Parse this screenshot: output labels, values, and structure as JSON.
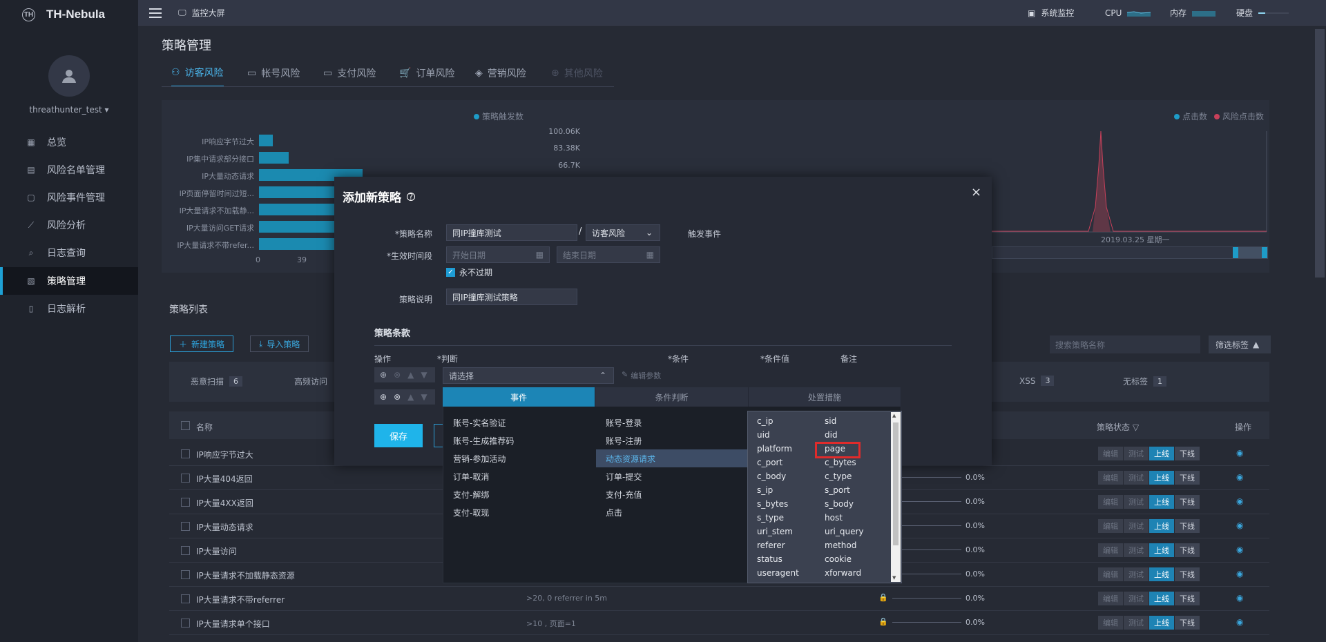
{
  "app": {
    "name": "TH-Nebula",
    "logo_mark": "TH"
  },
  "user": {
    "name": "threathunter_test"
  },
  "sidebar": {
    "items": [
      {
        "label": "总览",
        "icon": "grid-icon"
      },
      {
        "label": "风险名单管理",
        "icon": "id-card-icon"
      },
      {
        "label": "风险事件管理",
        "icon": "document-icon"
      },
      {
        "label": "风险分析",
        "icon": "line-chart-icon"
      },
      {
        "label": "日志查询",
        "icon": "search-icon"
      },
      {
        "label": "策略管理",
        "icon": "strategy-icon",
        "active": true
      },
      {
        "label": "日志解析",
        "icon": "file-icon"
      }
    ]
  },
  "topbar": {
    "monitor": "监控大屏",
    "system": "系统监控",
    "cpu": "CPU",
    "memory": "内存",
    "disk": "硬盘"
  },
  "page": {
    "title": "策略管理"
  },
  "tabs": [
    {
      "label": "访客风险",
      "icon": "user-icon",
      "active": true
    },
    {
      "label": "帐号风险",
      "icon": "account-icon"
    },
    {
      "label": "支付风险",
      "icon": "card-icon"
    },
    {
      "label": "订单风险",
      "icon": "cart-icon"
    },
    {
      "label": "营销风险",
      "icon": "tag-icon"
    },
    {
      "label": "其他风险",
      "icon": "plus-circle-icon",
      "disabled": true
    }
  ],
  "chart_data": [
    {
      "type": "bar",
      "legend": [
        "策略触发数"
      ],
      "categories": [
        "IP响应字节过大",
        "IP集中请求部分接口",
        "IP大量动态请求",
        "IP页面停留时间过短...",
        "IP大量请求不加载静...",
        "IP大量访问GET请求",
        "IP大量请求不带refer..."
      ],
      "values": [
        6,
        13,
        45,
        52,
        50,
        48,
        44
      ],
      "xticks": [
        "0",
        "39"
      ],
      "series_color": "#1b8ab0"
    },
    {
      "type": "line",
      "legend": [
        "点击数",
        "风险点击数"
      ],
      "yticks": [
        "100.06K",
        "83.38K",
        "66.7K"
      ],
      "xticks": [
        "2019.03.25 星期一"
      ],
      "series_colors": [
        "#1e9cc8",
        "#c8405a"
      ]
    }
  ],
  "list": {
    "title": "策略列表",
    "new_button": "新建策略",
    "import_button": "导入策略",
    "search_placeholder": "搜索策略名称",
    "filter_label": "筛选标签",
    "tags": [
      {
        "label": "恶意扫描",
        "count": "6"
      },
      {
        "label": "高频访问",
        "count": ""
      },
      {
        "label": "XSS",
        "count": "3"
      },
      {
        "label": "无标签",
        "count": "1"
      }
    ],
    "headers": {
      "name": "名称",
      "status": "策略状态",
      "ops": "操作"
    },
    "ops": [
      "编辑",
      "测试",
      "上线",
      "下线"
    ],
    "rows": [
      {
        "name": "IP响应字节过大",
        "cond": "",
        "pct": ""
      },
      {
        "name": "IP大量404返回",
        "cond": "",
        "pct": "0.0%"
      },
      {
        "name": "IP大量4XX返回",
        "cond": "",
        "pct": "0.0%"
      },
      {
        "name": "IP大量动态请求",
        "cond": "",
        "pct": "0.0%"
      },
      {
        "name": "IP大量访问",
        "cond": "",
        "pct": "0.0%"
      },
      {
        "name": "IP大量请求不加载静态资源",
        "cond": "",
        "pct": "0.0%"
      },
      {
        "name": "IP大量请求不带referrer",
        "cond": ">20, 0 referrer in 5m",
        "pct": "0.0%"
      },
      {
        "name": "IP大量请求单个接口",
        "cond": ">10 , 页面=1",
        "pct": "0.0%"
      }
    ]
  },
  "modal": {
    "title": "添加新策略",
    "close": "×",
    "name_label": "*策略名称",
    "name_value": "同IP撞库测试",
    "separator": "/",
    "category_value": "访客风险",
    "trigger_label": "触发事件",
    "period_label": "*生效时间段",
    "start_placeholder": "开始日期",
    "end_placeholder": "结束日期",
    "never_expire": "永不过期",
    "desc_label": "策略说明",
    "desc_value": "同IP撞库测试策略",
    "clause_title": "策略条款",
    "col_op": "操作",
    "col_judge": "*判断",
    "col_cond": "*条件",
    "col_value": "*条件值",
    "col_note": "备注",
    "select_placeholder": "请选择",
    "edit_params": "编辑参数",
    "save": "保存"
  },
  "dropdown": {
    "tabs": [
      "事件",
      "条件判断",
      "处置措施"
    ],
    "events_left": [
      "账号-实名验证",
      "账号-生成推荐码",
      "营销-参加活动",
      "订单-取消",
      "支付-解绑",
      "支付-取现"
    ],
    "events_right": [
      "账号-登录",
      "账号-注册",
      "动态资源请求",
      "订单-提交",
      "支付-充值",
      "点击"
    ],
    "selected_event": "动态资源请求",
    "fields_left": [
      "c_ip",
      "uid",
      "platform",
      "c_port",
      "c_body",
      "s_ip",
      "s_bytes",
      "s_type",
      "uri_stem",
      "referer",
      "status",
      "useragent"
    ],
    "fields_right": [
      "sid",
      "did",
      "page",
      "c_bytes",
      "c_type",
      "s_port",
      "s_body",
      "host",
      "uri_query",
      "method",
      "cookie",
      "xforward"
    ],
    "highlighted_field": "page"
  }
}
